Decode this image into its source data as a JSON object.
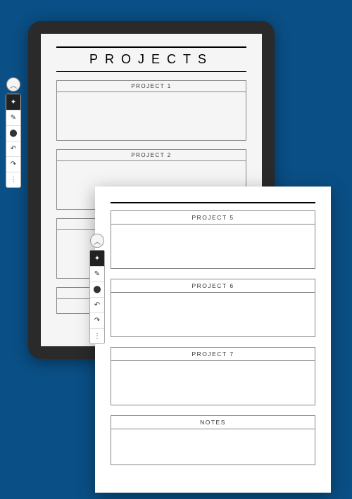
{
  "page1": {
    "title": "PROJECTS",
    "boxes": [
      {
        "label": "PROJECT 1"
      },
      {
        "label": "PROJECT 2"
      }
    ]
  },
  "page2": {
    "boxes": [
      {
        "label": "PROJECT 5"
      },
      {
        "label": "PROJECT 6"
      },
      {
        "label": "PROJECT 7"
      },
      {
        "label": "NOTES"
      }
    ]
  },
  "toolbar": {
    "collapse": "︿",
    "items": [
      "✦",
      "✎",
      "⬤",
      "↶",
      "↷",
      "⋮"
    ]
  }
}
